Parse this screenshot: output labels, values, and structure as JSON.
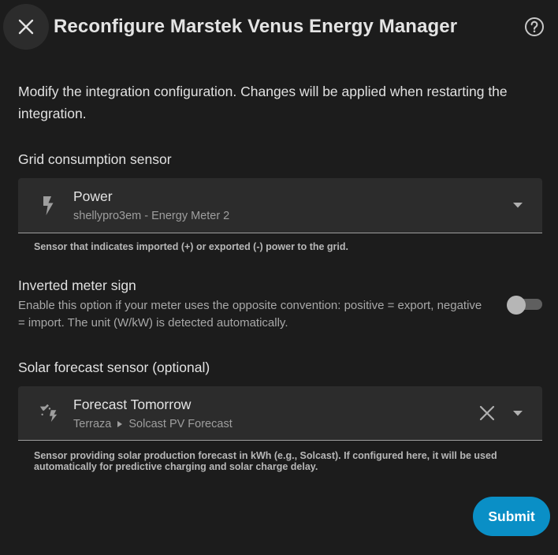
{
  "dialog": {
    "title": "Reconfigure Marstek Venus Energy Manager",
    "description": "Modify the integration configuration. Changes will be applied when restarting the integration."
  },
  "grid_sensor": {
    "label": "Grid consumption sensor",
    "selected_primary": "Power",
    "selected_secondary": "shellypro3em - Energy Meter 2",
    "icon": "flash-icon",
    "helper": "Sensor that indicates imported (+) or exported (-) power to the grid."
  },
  "inverted_meter": {
    "title": "Inverted meter sign",
    "description": "Enable this option if your meter uses the opposite convention: positive = export, negative = import. The unit (W/kW) is detected automatically.",
    "enabled": false
  },
  "solar_forecast": {
    "label": "Solar forecast sensor (optional)",
    "selected_primary": "Forecast Tomorrow",
    "area": "Terraza",
    "device": "Solcast PV Forecast",
    "icon": "weather-lightning-icon",
    "helper": "Sensor providing solar production forecast in kWh (e.g., Solcast). If configured here, it will be used automatically for predictive charging and solar charge delay."
  },
  "actions": {
    "submit_label": "Submit"
  },
  "colors": {
    "background": "#1c1c1c",
    "field": "#2c2c2c",
    "accent": "#0a8fc6"
  }
}
